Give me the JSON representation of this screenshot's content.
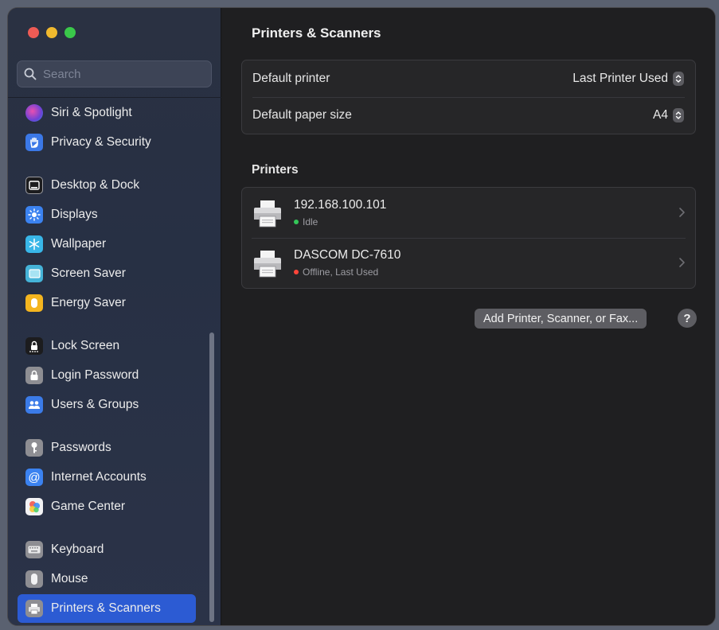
{
  "window": {
    "traffic_lights": [
      "close",
      "minimize",
      "zoom"
    ]
  },
  "sidebar": {
    "search_placeholder": "Search",
    "items": [
      {
        "label": "Siri & Spotlight",
        "icon": "siri-icon",
        "color": "#7b4fd0"
      },
      {
        "label": "Privacy & Security",
        "icon": "hand-icon",
        "color": "#3b78e7"
      },
      {
        "label": "Desktop & Dock",
        "icon": "dock-icon",
        "color": "#1c1c1e"
      },
      {
        "label": "Displays",
        "icon": "sun-icon",
        "color": "#3b82f0"
      },
      {
        "label": "Wallpaper",
        "icon": "snowflake-icon",
        "color": "#38b6e8"
      },
      {
        "label": "Screen Saver",
        "icon": "screen-saver-icon",
        "color": "#45b3d8"
      },
      {
        "label": "Energy Saver",
        "icon": "battery-icon",
        "color": "#f4b51f"
      },
      {
        "label": "Lock Screen",
        "icon": "lock-screen-icon",
        "color": "#1c1c1e"
      },
      {
        "label": "Login Password",
        "icon": "lock-icon",
        "color": "#8e8e93"
      },
      {
        "label": "Users & Groups",
        "icon": "users-icon",
        "color": "#3b7be8"
      },
      {
        "label": "Passwords",
        "icon": "key-icon",
        "color": "#8e8e93"
      },
      {
        "label": "Internet Accounts",
        "icon": "at-icon",
        "color": "#3b82f0"
      },
      {
        "label": "Game Center",
        "icon": "game-center-icon",
        "color": "#e9e9ea"
      },
      {
        "label": "Keyboard",
        "icon": "keyboard-icon",
        "color": "#8e8e93"
      },
      {
        "label": "Mouse",
        "icon": "mouse-icon",
        "color": "#8e8e93"
      },
      {
        "label": "Printers & Scanners",
        "icon": "printer-icon",
        "color": "#8e8e93",
        "active": true
      }
    ]
  },
  "main": {
    "title": "Printers & Scanners",
    "settings": [
      {
        "label": "Default printer",
        "value": "Last Printer Used"
      },
      {
        "label": "Default paper size",
        "value": "A4"
      }
    ],
    "printers_heading": "Printers",
    "printers": [
      {
        "name": "192.168.100.101",
        "status": "Idle",
        "status_color": "#34c759"
      },
      {
        "name": "DASCOM DC-7610",
        "status": "Offline, Last Used",
        "status_color": "#ff453a"
      }
    ],
    "add_button": "Add Printer, Scanner, or Fax...",
    "help_button": "?"
  },
  "colors": {
    "accent": "#2c5bd3",
    "window_bg": "#1f1f21",
    "sidebar_bg": "#2a3142"
  }
}
